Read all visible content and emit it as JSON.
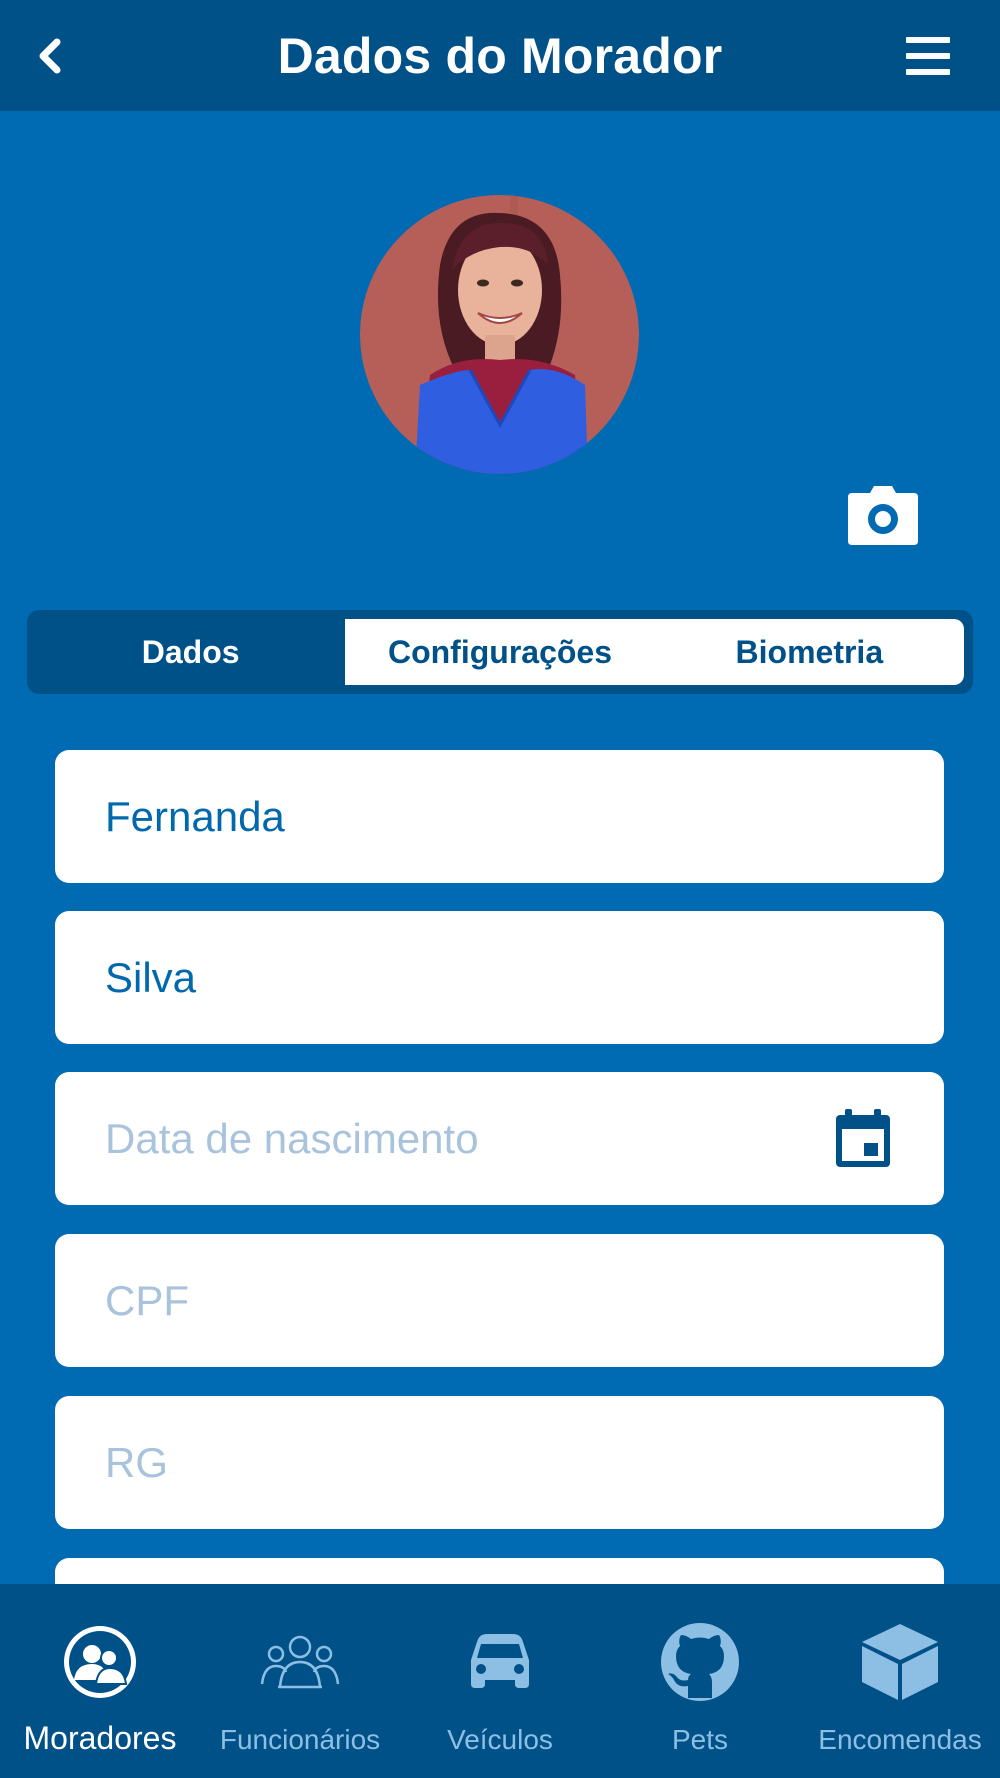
{
  "header": {
    "title": "Dados do Morador",
    "back_icon": "chevron-left-icon",
    "menu_icon": "hamburger-menu-icon"
  },
  "profile": {
    "photo": "resident-photo",
    "camera_icon": "camera-icon"
  },
  "tabs": [
    {
      "label": "Dados",
      "active": true
    },
    {
      "label": "Configurações",
      "active": false
    },
    {
      "label": "Biometria",
      "active": false
    }
  ],
  "form": {
    "first_name": {
      "value": "Fernanda",
      "placeholder": ""
    },
    "last_name": {
      "value": "Silva",
      "placeholder": ""
    },
    "birth_date": {
      "value": "",
      "placeholder": "Data de nascimento",
      "icon": "calendar-icon"
    },
    "cpf": {
      "value": "",
      "placeholder": "CPF"
    },
    "rg": {
      "value": "",
      "placeholder": "RG"
    }
  },
  "bottom_nav": [
    {
      "label": "Moradores",
      "icon": "residents-icon",
      "active": true
    },
    {
      "label": "Funcionários",
      "icon": "employees-icon",
      "active": false
    },
    {
      "label": "Veículos",
      "icon": "car-icon",
      "active": false
    },
    {
      "label": "Pets",
      "icon": "github-cat-icon",
      "active": false
    },
    {
      "label": "Encomendas",
      "icon": "package-icon",
      "active": false
    }
  ],
  "colors": {
    "background": "#006bb3",
    "header": "#005188",
    "text_value": "#0068ad",
    "placeholder": "#a9c3dd",
    "nav_inactive": "#8dbfe4"
  }
}
